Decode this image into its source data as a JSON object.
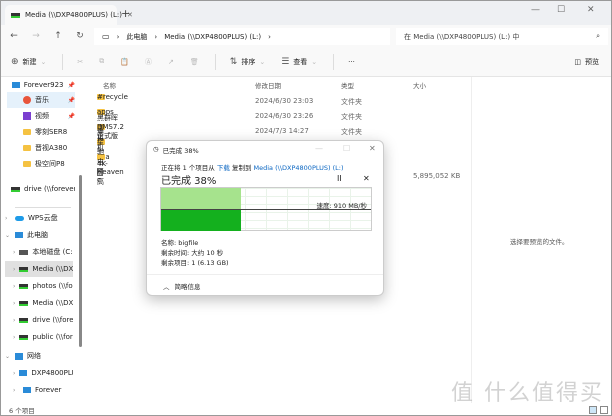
{
  "window": {
    "tab_title": "Media (\\\\DXP4800PLUS) (L:)",
    "new_tab": "+",
    "minimize": "—",
    "maximize": "☐",
    "close": "✕"
  },
  "address": {
    "crumbs": [
      "此电脑",
      "Media (\\\\DXP4800PLUS) (L:)"
    ],
    "search_placeholder": "在 Media (\\\\DXP4800PLUS) (L:) 中"
  },
  "toolbar": {
    "new": "新建",
    "sort": "排序",
    "view": "查看",
    "more": "···",
    "preview": "预览"
  },
  "sidebar": {
    "items": [
      {
        "label": "Forever923",
        "icon": "desktop-icon"
      },
      {
        "label": "音乐",
        "icon": "music-icon"
      },
      {
        "label": "视频",
        "icon": "video-icon"
      },
      {
        "label": "零刻SER8",
        "icon": "folder-icon"
      },
      {
        "label": "晋视A380",
        "icon": "folder-icon"
      },
      {
        "label": "极空间P8",
        "icon": "folder-icon"
      },
      {
        "label": "drive (\\\\forever",
        "icon": "drive-icon"
      },
      {
        "label": "WPS云盘",
        "icon": "cloud-icon"
      },
      {
        "label": "此电脑",
        "icon": "pc-icon"
      },
      {
        "label": "本地磁盘 (C:)",
        "icon": "disk-icon"
      },
      {
        "label": "Media (\\\\DXP",
        "icon": "drive-icon"
      },
      {
        "label": "photos (\\\\fore",
        "icon": "drive-icon"
      },
      {
        "label": "Media (\\\\DXP",
        "icon": "drive-icon"
      },
      {
        "label": "drive (\\\\forev",
        "icon": "drive-icon"
      },
      {
        "label": "public (\\\\fore",
        "icon": "drive-icon"
      },
      {
        "label": "网络",
        "icon": "network-icon"
      },
      {
        "label": "DXP4800PLU",
        "icon": "desktop-icon"
      },
      {
        "label": "Forever",
        "icon": "desktop-icon"
      }
    ]
  },
  "columns": [
    "名称",
    "修改日期",
    "类型",
    "大小"
  ],
  "files": [
    {
      "name": "#recycle",
      "date": "2024/6/30 23:03",
      "type": "文件夹",
      "size": ""
    },
    {
      "name": "apps",
      "date": "2024/6/30 23:26",
      "type": "文件夹",
      "size": ""
    },
    {
      "name": "黑群晖DMS7.2正式版",
      "date": "2024/7/3 14:27",
      "type": "文件夹",
      "size": ""
    },
    {
      "name": "虚拟机ova",
      "date": "",
      "type": "",
      "size": ""
    },
    {
      "name": "周星驰电影高",
      "date": "",
      "type": "",
      "size": ""
    },
    {
      "name": "4K-Heaven c",
      "date": "",
      "type": "",
      "size": "5,895,052 KB"
    }
  ],
  "preview_text": "选择要预览的文件。",
  "status": "6 个项目",
  "watermark": "值 什么值得买",
  "dialog": {
    "title": "已完成 38%",
    "line_prefix": "正在将 1 个项目从",
    "source": "下载",
    "mid": "复制到",
    "dest": "Media (\\\\DXP4800PLUS) (L:)",
    "progress_label": "已完成 38%",
    "progress_percent": 38,
    "speed": "速度: 910 MB/秒",
    "name": "名称: bigfile",
    "time_left": "剩余时间: 大约 10 秒",
    "items_left": "剩余项目: 1 (6.13 GB)",
    "less_details": "简略信息",
    "pause": "II",
    "cancel": "✕"
  },
  "colors": {
    "progress_light": "#a6e38d",
    "progress_dark": "#14b01e",
    "link": "#0a66c2"
  }
}
